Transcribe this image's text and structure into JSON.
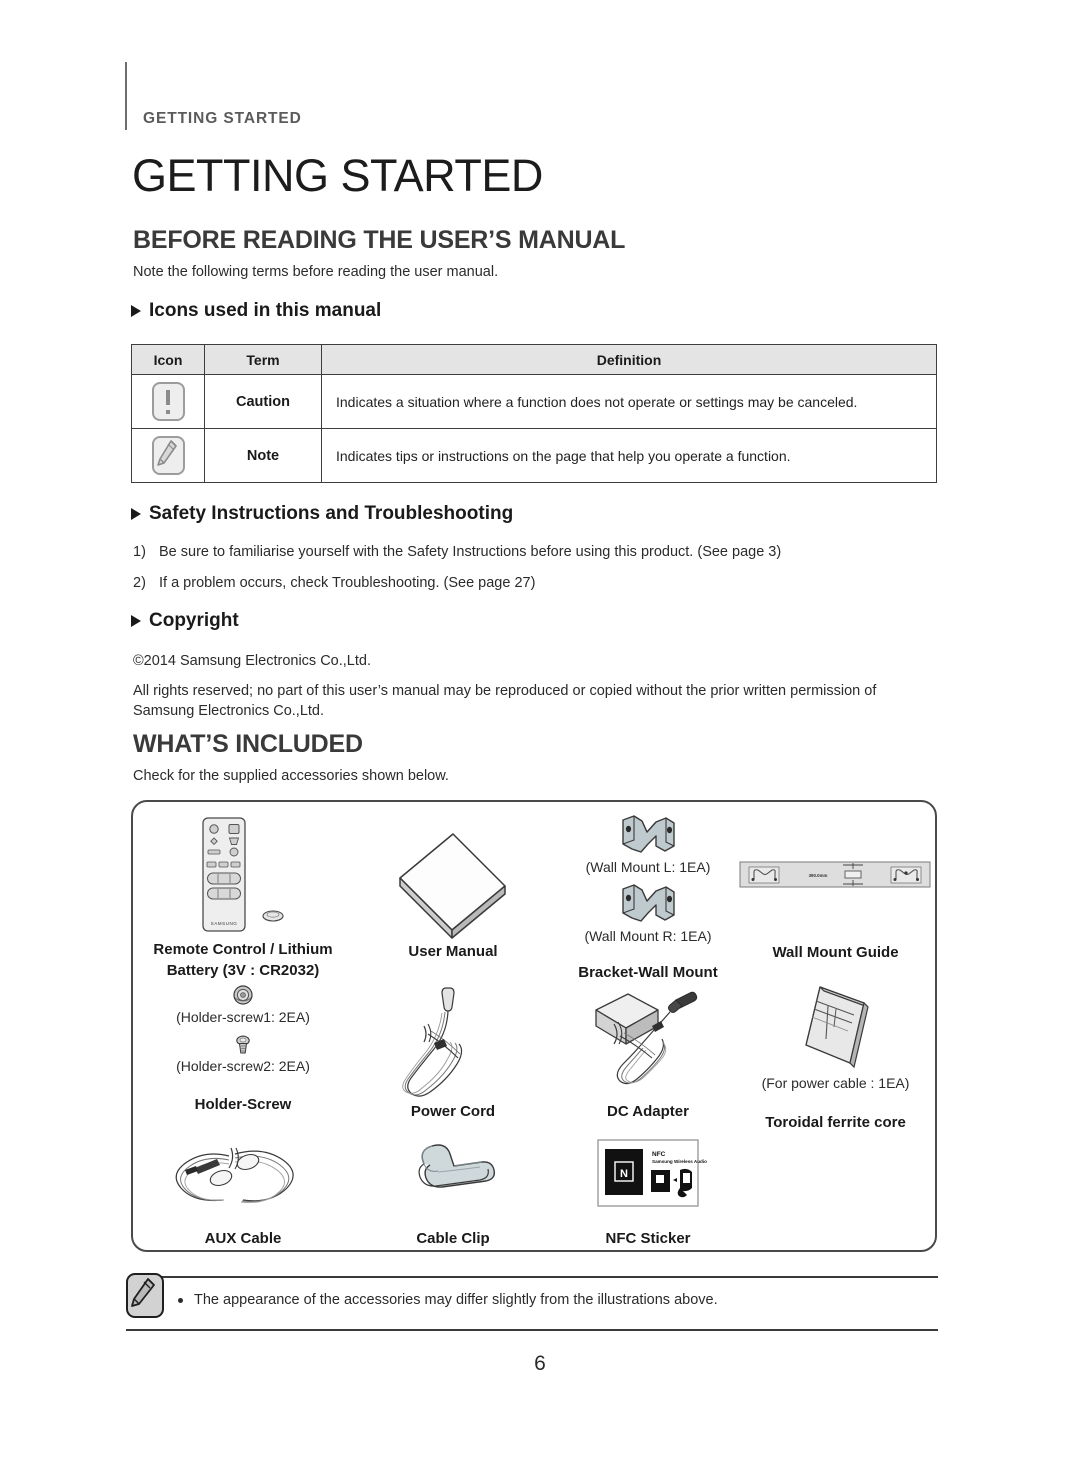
{
  "running_header": {
    "label": "GETTING STARTED"
  },
  "page_title": "GETTING STARTED",
  "sections": {
    "before_reading": {
      "heading": "BEFORE READING THE USER’S MANUAL",
      "intro": "Note the following terms before reading the user manual.",
      "icons_subheading": "Icons used in this manual",
      "table": {
        "headers": [
          "Icon",
          "Term",
          "Definition"
        ],
        "rows": [
          {
            "icon": "caution-icon",
            "term": "Caution",
            "definition": "Indicates a situation where a function does not operate or settings may be canceled."
          },
          {
            "icon": "note-pencil-icon",
            "term": "Note",
            "definition": "Indicates tips or instructions on the page that help you operate a function."
          }
        ]
      },
      "safety_subheading": "Safety Instructions and Troubleshooting",
      "safety_items": [
        {
          "number": "1)",
          "text": "Be sure to familiarise yourself with the Safety Instructions before using this product. (See page 3)"
        },
        {
          "number": "2)",
          "text": "If a problem occurs, check Troubleshooting. (See page 27)"
        }
      ],
      "copyright_subheading": "Copyright",
      "copyright_line1": "©2014 Samsung Electronics Co.,Ltd.",
      "copyright_line2": "All rights reserved; no part of this user’s manual may be reproduced or copied without the prior written permission of Samsung Electronics Co.,Ltd."
    },
    "whats_included": {
      "heading": "WHAT’S INCLUDED",
      "intro": "Check for the supplied accessories shown below.",
      "accessories": [
        {
          "id": "remote-control",
          "caption": "Remote Control / Lithium Battery (3V : CR2032)",
          "sub": "",
          "brand": "SAMSUNG"
        },
        {
          "id": "user-manual",
          "caption": "User Manual",
          "sub": ""
        },
        {
          "id": "bracket-wall-mount",
          "caption": "Bracket-Wall Mount",
          "sub_lines": [
            "(Wall Mount L: 1EA)",
            "(Wall Mount R: 1EA)"
          ]
        },
        {
          "id": "wall-mount-guide",
          "caption": "Wall Mount Guide",
          "sub": "",
          "dimension": "390.0mm"
        },
        {
          "id": "holder-screw",
          "caption": "Holder-Screw",
          "sub_lines": [
            "(Holder-screw1: 2EA)",
            "(Holder-screw2: 2EA)"
          ]
        },
        {
          "id": "power-cord",
          "caption": "Power Cord",
          "sub": ""
        },
        {
          "id": "dc-adapter",
          "caption": "DC Adapter",
          "sub": ""
        },
        {
          "id": "toroidal-ferrite-core",
          "caption": "Toroidal ferrite core",
          "sub": "(For power cable : 1EA)"
        },
        {
          "id": "aux-cable",
          "caption": "AUX Cable",
          "sub": ""
        },
        {
          "id": "cable-clip",
          "caption": "Cable Clip",
          "sub": ""
        },
        {
          "id": "nfc-sticker",
          "caption": "NFC Sticker",
          "sub": "",
          "sticker_title": "NFC",
          "sticker_subtitle": "Samsung Wireless Audio",
          "sticker_mark": "N"
        }
      ]
    }
  },
  "footer_note": {
    "icon": "note-pencil-icon",
    "bullet": "•",
    "text": "The appearance of the accessories may differ slightly from the illustrations above."
  },
  "page_number": "6",
  "colors": {
    "heading_gray": "#3a3a3a",
    "running_gray": "#5b5b5b",
    "table_header_bg": "#e4e4e4",
    "rule": "#3a3a3a"
  }
}
